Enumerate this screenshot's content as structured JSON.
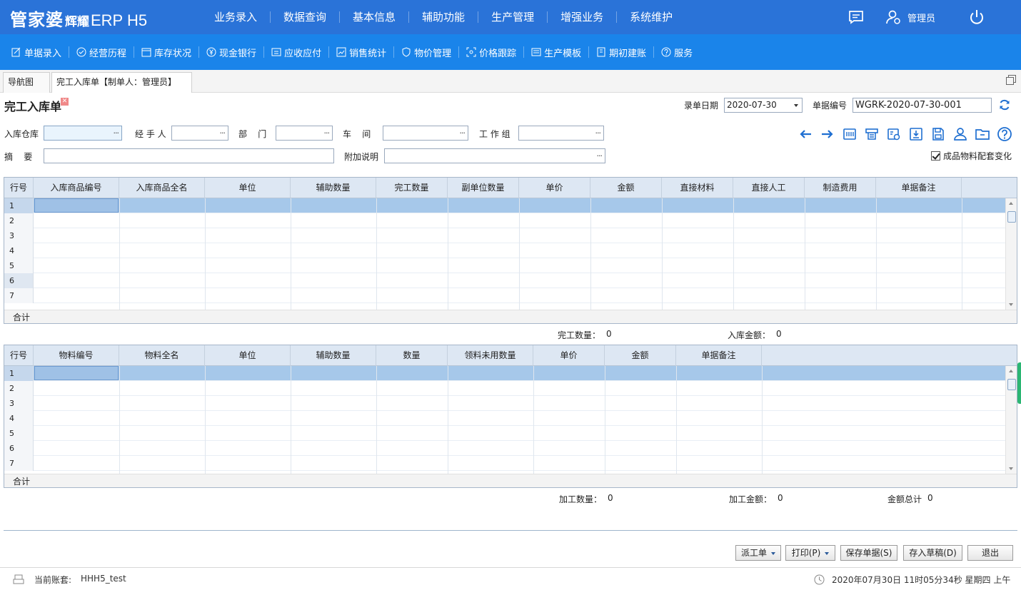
{
  "header": {
    "logo_brand": "管家婆",
    "logo_product": "辉耀",
    "logo_suffix": "ERP H5",
    "nav": [
      "业务录入",
      "数据查询",
      "基本信息",
      "辅助功能",
      "生产管理",
      "增强业务",
      "系统维护"
    ],
    "user": "管理员",
    "icons": [
      "message-icon",
      "user-icon",
      "power-icon"
    ]
  },
  "subnav": [
    {
      "label": "单据录入",
      "icon": "edit-icon"
    },
    {
      "label": "经营历程",
      "icon": "check-circle-icon"
    },
    {
      "label": "库存状况",
      "icon": "calendar-icon"
    },
    {
      "label": "现金银行",
      "icon": "yen-icon"
    },
    {
      "label": "应收应付",
      "icon": "swap-icon"
    },
    {
      "label": "销售统计",
      "icon": "chart-icon"
    },
    {
      "label": "物价管理",
      "icon": "shield-icon"
    },
    {
      "label": "价格跟踪",
      "icon": "scan-icon"
    },
    {
      "label": "生产模板",
      "icon": "template-icon"
    },
    {
      "label": "期初建账",
      "icon": "ledger-icon"
    },
    {
      "label": "服务",
      "icon": "help-icon"
    }
  ],
  "tabs": [
    {
      "label": "导航图"
    },
    {
      "label": "完工入库单【制单人：管理员】"
    }
  ],
  "form": {
    "title": "完工入库单",
    "date_label": "录单日期",
    "date_value": "2020-07-30",
    "number_label": "单据编号",
    "number_value": "WGRK-2020-07-30-001",
    "warehouse_label": "入库仓库",
    "handler_label": "经 手 人",
    "dept_label": "部    门",
    "workshop_label": "车    间",
    "team_label": "工 作 组",
    "summary_label": "摘    要",
    "note_label": "附加说明",
    "checkbox_label": "成品物料配套变化"
  },
  "grid1": {
    "columns": [
      "行号",
      "入库商品编号",
      "入库商品全名",
      "单位",
      "辅助数量",
      "完工数量",
      "副单位数量",
      "单价",
      "金额",
      "直接材料",
      "直接人工",
      "制造费用",
      "单据备注"
    ],
    "rows": [
      "1",
      "2",
      "3",
      "4",
      "5",
      "6",
      "7"
    ],
    "footer": "合计"
  },
  "summary1": {
    "done_qty_label": "完工数量：",
    "done_qty_value": "0",
    "in_amount_label": "入库金额：",
    "in_amount_value": "0"
  },
  "grid2": {
    "columns": [
      "行号",
      "物料编号",
      "物料全名",
      "单位",
      "辅助数量",
      "数量",
      "领料未用数量",
      "单价",
      "金额",
      "单据备注"
    ],
    "rows": [
      "1",
      "2",
      "3",
      "4",
      "5",
      "6",
      "7"
    ],
    "footer": "合计"
  },
  "summary2": {
    "proc_qty_label": "加工数量：",
    "proc_qty_value": "0",
    "proc_amount_label": "加工金额：",
    "proc_amount_value": "0",
    "total_label": "金额总计",
    "total_value": "0"
  },
  "buttons": {
    "dispatch": "派工单",
    "print": "打印(P)",
    "save": "保存单据(S)",
    "draft": "存入草稿(D)",
    "exit": "退出"
  },
  "status": {
    "account_label": "当前账套:",
    "account_value": "HHH5_test",
    "datetime": "2020年07月30日 11时05分34秒 星期四 上午"
  },
  "colors": {
    "topbar": "#2a73d8",
    "subbar": "#1a84ea",
    "tool_icon": "#1f6fd1",
    "row_selected": "#a6c8ea"
  }
}
